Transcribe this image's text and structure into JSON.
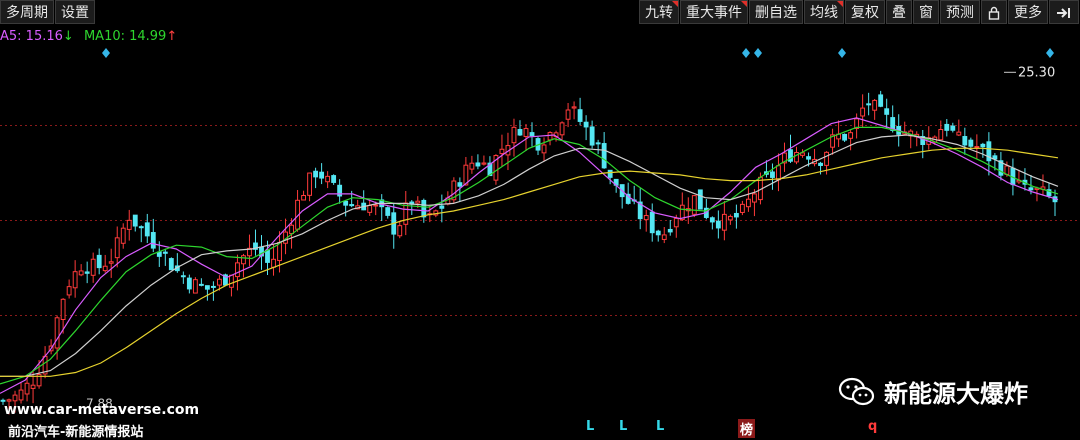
{
  "toolbar": {
    "left": [
      "多周期",
      "设置"
    ],
    "right": [
      "九转",
      "重大事件",
      "删自选",
      "均线",
      "复权",
      "叠",
      "窗",
      "预测"
    ],
    "lock_icon": "lock-icon",
    "more": "更多",
    "exit_icon": "exit-arrow-icon"
  },
  "ma_legend": {
    "ma5_label": "A5: 15.16",
    "ma5_arrow": "↓",
    "ma10_label": "MA10: 14.99",
    "ma10_arrow": "↑"
  },
  "colors": {
    "bg": "#000000",
    "up": "#ff3b3b",
    "down": "#54e6f2",
    "ma5": "#ffffff",
    "ma10": "#d85cff",
    "ma20": "#2ed62e",
    "ma60": "#e6d22e",
    "ma_white": "#cfcfcf",
    "gridline": "#8b1a1a",
    "diamond": "#35b6e8"
  },
  "watermark": {
    "url": "www.car-metaverse.com",
    "site": "前沿汽车-新能源情报站",
    "wechat_name": "新能源大爆炸"
  },
  "signals": [
    "L",
    "L",
    "L",
    "榜",
    "q"
  ],
  "chart_data": {
    "type": "candlestick",
    "title": "",
    "price_label_high": "25.30",
    "price_label_low": "7.88",
    "candle_count": 176,
    "ylim": [
      7,
      27
    ],
    "close_path": [
      8.0,
      8.3,
      9.2,
      11.0,
      14.0,
      15.2,
      15.0,
      15.6,
      17.8,
      16.9,
      16.0,
      14.9,
      14.2,
      13.9,
      14.3,
      15.4,
      16.1,
      15.1,
      16.9,
      18.9,
      20.2,
      19.2,
      18.3,
      18.4,
      18.0,
      17.0,
      18.6,
      17.4,
      18.3,
      19.6,
      20.7,
      20.3,
      21.6,
      22.5,
      21.6,
      22.2,
      23.5,
      22.5,
      21.2,
      19.2,
      18.3,
      17.4,
      16.7,
      18.0,
      18.7,
      17.7,
      17.4,
      17.8,
      19.2,
      19.9,
      21.0,
      21.2,
      20.7,
      21.9,
      22.0,
      23.8,
      23.0,
      22.4,
      21.9,
      21.8,
      22.6,
      21.6,
      21.4,
      20.7,
      20.0,
      19.1,
      19.0,
      18.5
    ],
    "ma_lines": [
      {
        "values": [
          8.4,
          9.1,
          10.7,
          12.8,
          14.5,
          15.6,
          16.3,
          16.0,
          15.2,
          14.5,
          15.1,
          16.6,
          18.0,
          18.9,
          18.9,
          18.4,
          18.1,
          18.0,
          18.9,
          20.0,
          21.0,
          21.9,
          22.0,
          21.1,
          19.9,
          18.7,
          17.9,
          17.6,
          17.9,
          19.0,
          20.3,
          21.0,
          21.8,
          22.6,
          22.9,
          22.5,
          22.1,
          21.6,
          21.0,
          20.3,
          19.5,
          19.0,
          18.6
        ]
      },
      {
        "values": [
          8.9,
          9.3,
          10.2,
          11.7,
          13.3,
          14.8,
          15.7,
          16.2,
          16.1,
          15.6,
          15.5,
          16.2,
          17.2,
          18.2,
          18.7,
          18.6,
          18.3,
          18.2,
          18.7,
          19.5,
          20.4,
          21.3,
          21.8,
          21.5,
          20.7,
          19.6,
          18.7,
          18.1,
          18.0,
          18.6,
          19.6,
          20.5,
          21.2,
          21.9,
          22.4,
          22.4,
          22.1,
          21.7,
          21.2,
          20.6,
          19.9,
          19.3,
          18.9
        ]
      },
      {
        "values": [
          9.3,
          9.3,
          9.6,
          10.5,
          11.7,
          13.0,
          14.1,
          15.0,
          15.7,
          15.9,
          16.0,
          16.3,
          16.8,
          17.5,
          18.1,
          18.4,
          18.4,
          18.3,
          18.4,
          18.8,
          19.4,
          20.2,
          20.9,
          21.3,
          21.2,
          20.6,
          19.9,
          19.2,
          18.7,
          18.6,
          19.0,
          19.7,
          20.4,
          21.0,
          21.6,
          21.9,
          22.0,
          21.8,
          21.5,
          21.0,
          20.4,
          19.8,
          19.3
        ]
      },
      {
        "values": [
          9.3,
          9.3,
          9.3,
          9.5,
          10.0,
          10.8,
          11.7,
          12.6,
          13.4,
          14.1,
          14.6,
          15.1,
          15.6,
          16.1,
          16.6,
          17.1,
          17.5,
          17.8,
          18.0,
          18.3,
          18.6,
          19.0,
          19.4,
          19.8,
          20.0,
          20.1,
          20.0,
          19.9,
          19.7,
          19.6,
          19.6,
          19.7,
          19.9,
          20.2,
          20.5,
          20.8,
          21.0,
          21.2,
          21.3,
          21.3,
          21.2,
          21.0,
          20.8
        ]
      }
    ]
  }
}
